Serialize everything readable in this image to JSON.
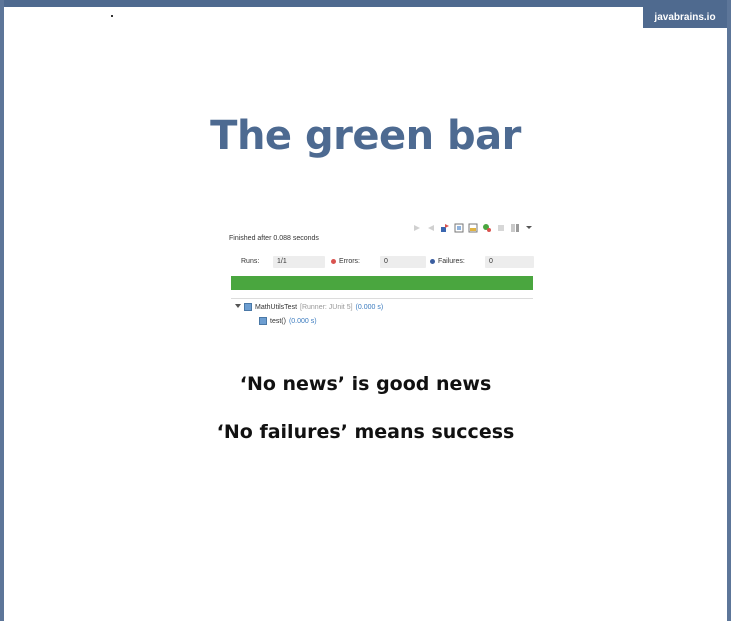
{
  "brand": {
    "label": "javabrains.io"
  },
  "slide": {
    "title": "The green bar",
    "captions": [
      "‘No news’ is good news",
      "‘No failures’ means success"
    ]
  },
  "junit": {
    "finished_text": "Finished after 0.088 seconds",
    "runs_label": "Runs:",
    "runs_value": "1/1",
    "errors_label": "Errors:",
    "errors_value": "0",
    "failures_label": "Failures:",
    "failures_value": "0",
    "progress": 1.0,
    "colors": {
      "progress": "#4aa63f",
      "error_dot": "#d9534f",
      "failure_dot": "#3b5ea0"
    },
    "tree": {
      "root": {
        "name": "MathUtilsTest",
        "runner": "[Runner: JUnit 5]",
        "time": "(0.000 s)"
      },
      "child": {
        "name": "test()",
        "time": "(0.000 s)"
      }
    }
  },
  "icons": {
    "toolbar": [
      "next-failure-icon",
      "prev-failure-icon",
      "rerun-icon",
      "history-icon",
      "lock-icon",
      "filter-icon",
      "stop-icon",
      "layout-icon",
      "menu-chevron-icon"
    ]
  }
}
